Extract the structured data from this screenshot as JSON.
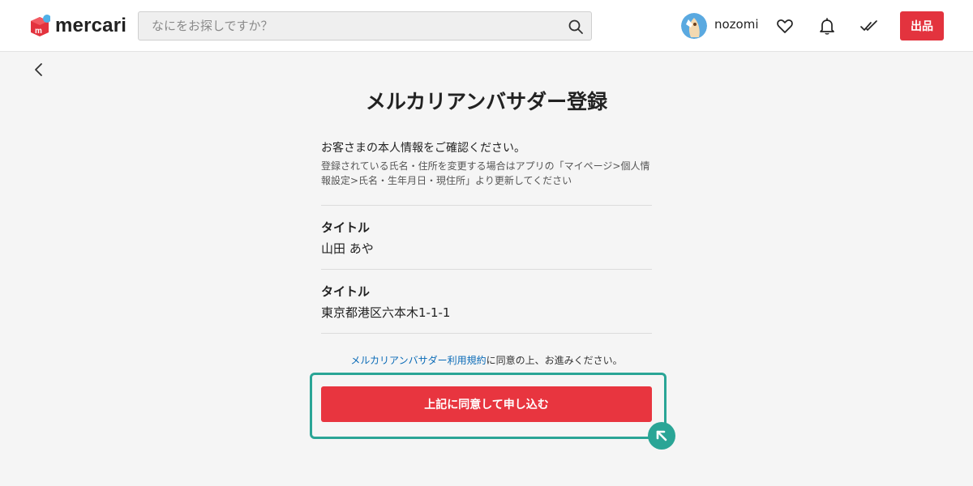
{
  "header": {
    "logo_text": "mercari",
    "search_placeholder": "なにをお探しですか？",
    "username": "nozomi",
    "sell_label": "出品",
    "icons": [
      "search-icon",
      "heart-icon",
      "bell-icon",
      "check-icon"
    ]
  },
  "main": {
    "title": "メルカリアンバサダー登録",
    "intro": "お客さまの本人情報をご確認ください。",
    "note_line1": "登録されている氏名・住所を変更する場合はアプリの「マイページ>個人情",
    "note_line2": "報設定>氏名・生年月日・現住所」より更新してください",
    "fields": [
      {
        "label": "タイトル",
        "value": "山田 あや"
      },
      {
        "label": "タイトル",
        "value": "東京都港区六本木1-1-1"
      }
    ],
    "terms_link": "メルカリアンバサダー利用規約",
    "terms_suffix": "に同意の上、お進みください。",
    "apply_label": "上記に同意して申し込む"
  },
  "colors": {
    "accent_red": "#e3333e",
    "highlight_teal": "#2aa596",
    "link_blue": "#0a6bb7"
  }
}
